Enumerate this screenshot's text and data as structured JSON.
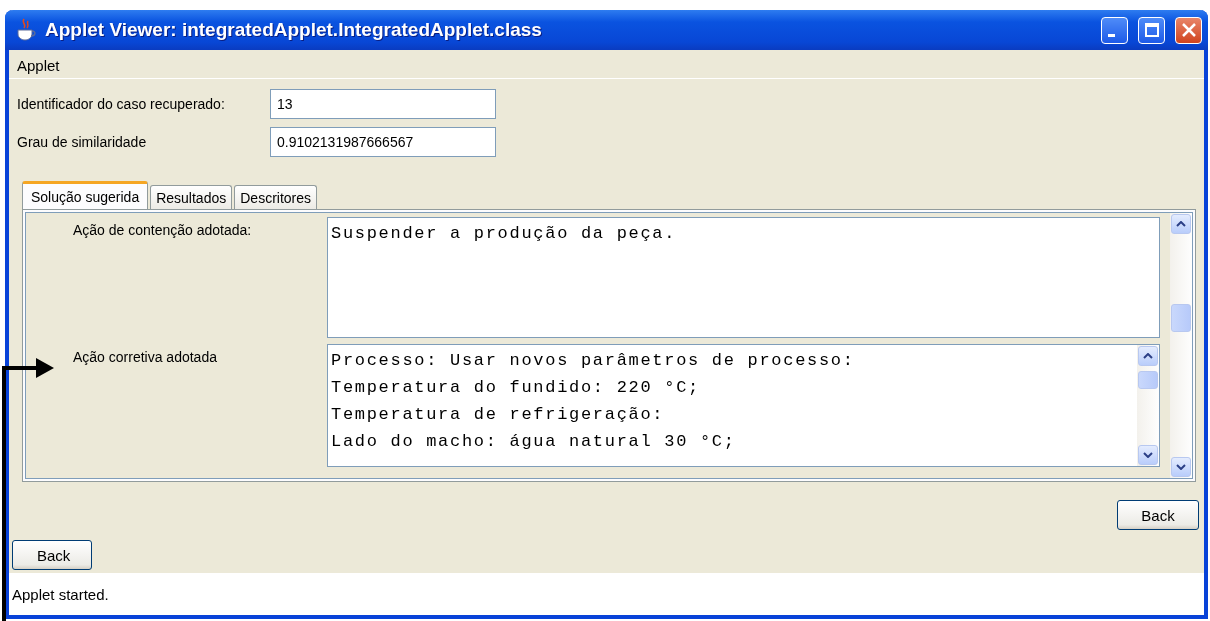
{
  "window": {
    "title": "Applet Viewer: integratedApplet.IntegratedApplet.class"
  },
  "menu": [
    {
      "label": "Applet"
    }
  ],
  "fields": [
    {
      "label": "Identificador do caso recuperado:",
      "value": "13"
    },
    {
      "label": "Grau de similaridade",
      "value": "0.9102131987666567"
    }
  ],
  "tabs": [
    {
      "label": "Solução sugerida",
      "selected": true
    },
    {
      "label": "Resultados",
      "selected": false
    },
    {
      "label": "Descritores",
      "selected": false
    }
  ],
  "solution": [
    {
      "label": "Ação de contenção adotada:",
      "lines": [
        "Suspender a produção da peça."
      ]
    },
    {
      "label": "Ação corretiva adotada",
      "lines": [
        "Processo: Usar novos parâmetros de processo:",
        "Temperatura do fundido: 220 °C;",
        "Temperatura de refrigeração:",
        "Lado do macho: água natural 30 °C;"
      ]
    }
  ],
  "panel_button": {
    "label": "Back"
  },
  "applet_button": {
    "label": "Back"
  },
  "status_bar": {
    "text": "Applet started."
  }
}
